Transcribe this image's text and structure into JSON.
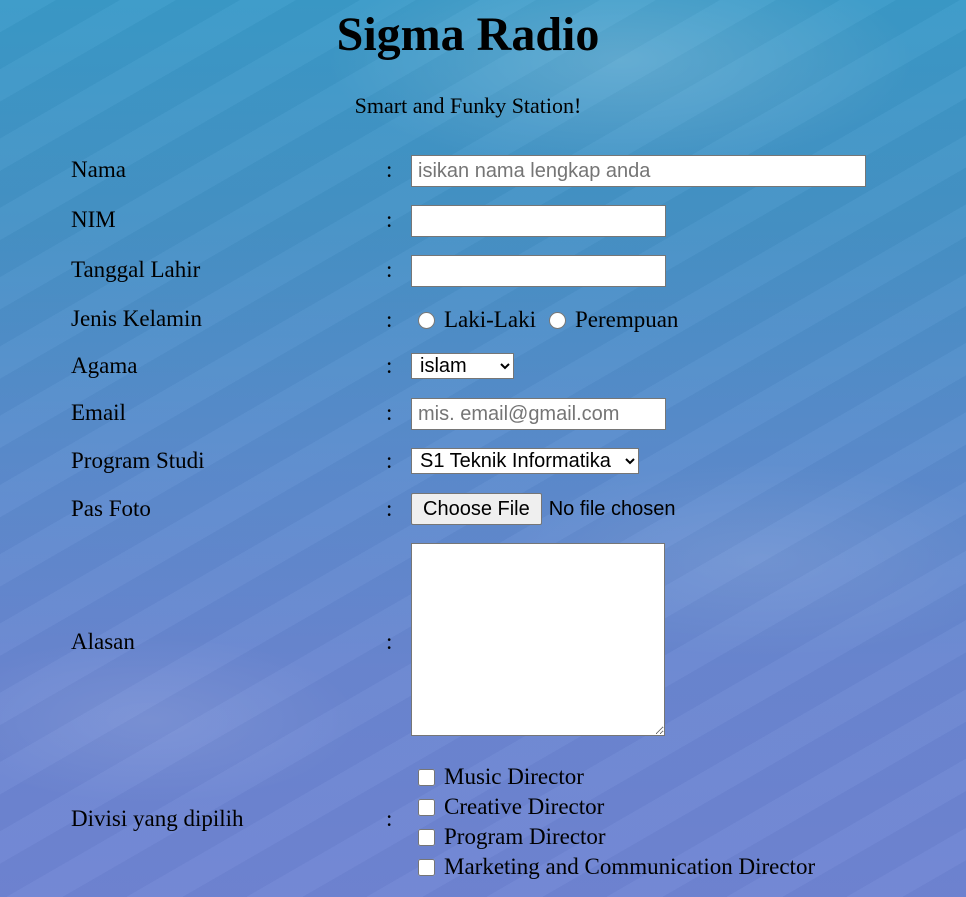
{
  "page": {
    "title": "Sigma Radio",
    "subtitle": "Smart and Funky Station!"
  },
  "form": {
    "colon": ":",
    "nama": {
      "label": "Nama",
      "placeholder": "isikan nama lengkap anda",
      "value": ""
    },
    "nim": {
      "label": "NIM",
      "value": ""
    },
    "tanggal_lahir": {
      "label": "Tanggal Lahir",
      "value": ""
    },
    "jenis_kelamin": {
      "label": "Jenis Kelamin",
      "options": [
        "Laki-Laki",
        "Perempuan"
      ],
      "selected": null
    },
    "agama": {
      "label": "Agama",
      "selected": "islam"
    },
    "email": {
      "label": "Email",
      "placeholder": "mis. email@gmail.com",
      "value": ""
    },
    "program_studi": {
      "label": "Program Studi",
      "selected": "S1 Teknik Informatika"
    },
    "pas_foto": {
      "label": "Pas Foto",
      "button_label": "Choose File",
      "status": "No file chosen"
    },
    "alasan": {
      "label": "Alasan",
      "value": ""
    },
    "divisi": {
      "label": "Divisi yang dipilih",
      "options": [
        "Music Director",
        "Creative Director",
        "Program Director",
        "Marketing and Communication Director"
      ],
      "checked": []
    }
  }
}
